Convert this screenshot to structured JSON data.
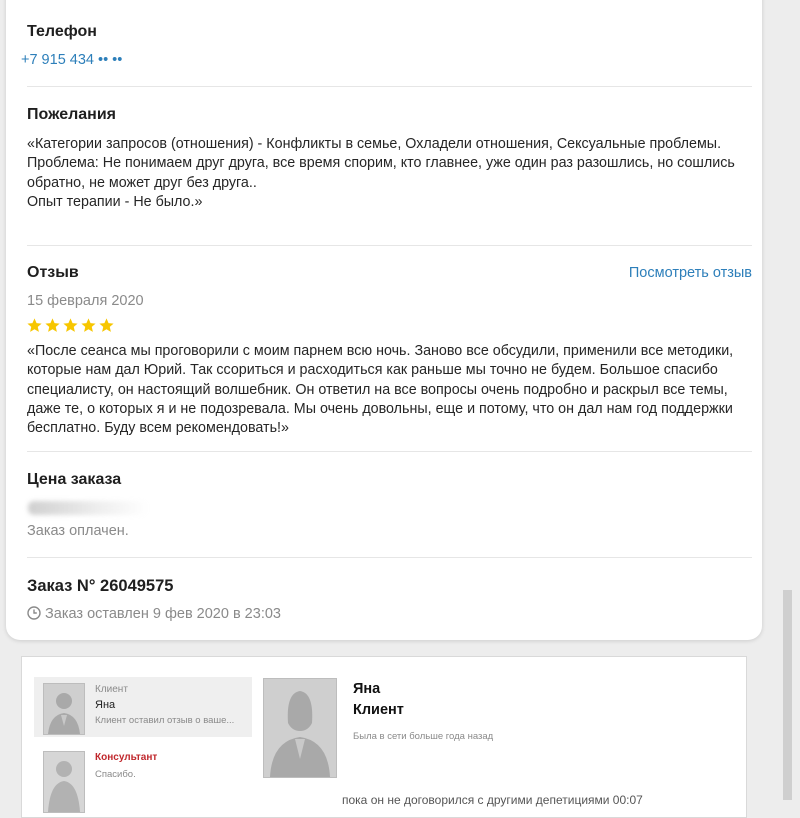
{
  "phone": {
    "label": "Телефон",
    "value": "+7 915 434 •• ••"
  },
  "wishes": {
    "label": "Пожелания",
    "text": "«Категории запросов (отношения) - Конфликты в семье, Охладели отношения, Сексуальные проблемы.\nПроблема: Не понимаем друг друга, все время спорим, кто главнее, уже один раз разошлись, но сошлись обратно, не может друг без друга..\nОпыт терапии - Не было.»"
  },
  "review": {
    "label": "Отзыв",
    "view_link": "Посмотреть отзыв",
    "date": "15 февраля 2020",
    "rating": 5,
    "star_color": "#f7c600",
    "text": "«После сеанса мы проговорили с моим парнем всю ночь. Заново все обсудили, применили все методики, которые нам дал Юрий. Так ссориться и расходиться как раньше мы точно не будем. Большое спасибо специалисту, он настоящий волшебник. Он ответил на все вопросы очень подробно и раскрыл все темы, даже те, о которых я и не подозревала. Мы очень довольны, еще и потому, что он дал нам год поддержки бесплатно. Буду всем рекомендовать!»"
  },
  "price": {
    "label": "Цена заказа",
    "status": "Заказ оплачен."
  },
  "order": {
    "title": "Заказ N° 26049575",
    "placed": "Заказ оставлен 9 фев 2020 в 23:03",
    "icon": "clock-icon"
  },
  "messenger": {
    "threads": [
      {
        "role": "Клиент",
        "name": "Яна",
        "preview": "Клиент оставил отзыв о ваше..."
      },
      {
        "role": "Консультант",
        "name": "",
        "preview": "Спасибо."
      }
    ],
    "profile": {
      "name": "Яна",
      "role": "Клиент",
      "status": "Была в сети больше года назад"
    },
    "cut_text": "пока он не договорился с другими депетициями   00:07"
  },
  "colors": {
    "link": "#2d7fba",
    "consultant_role": "#c0282d",
    "accent_star": "#f7c600"
  }
}
